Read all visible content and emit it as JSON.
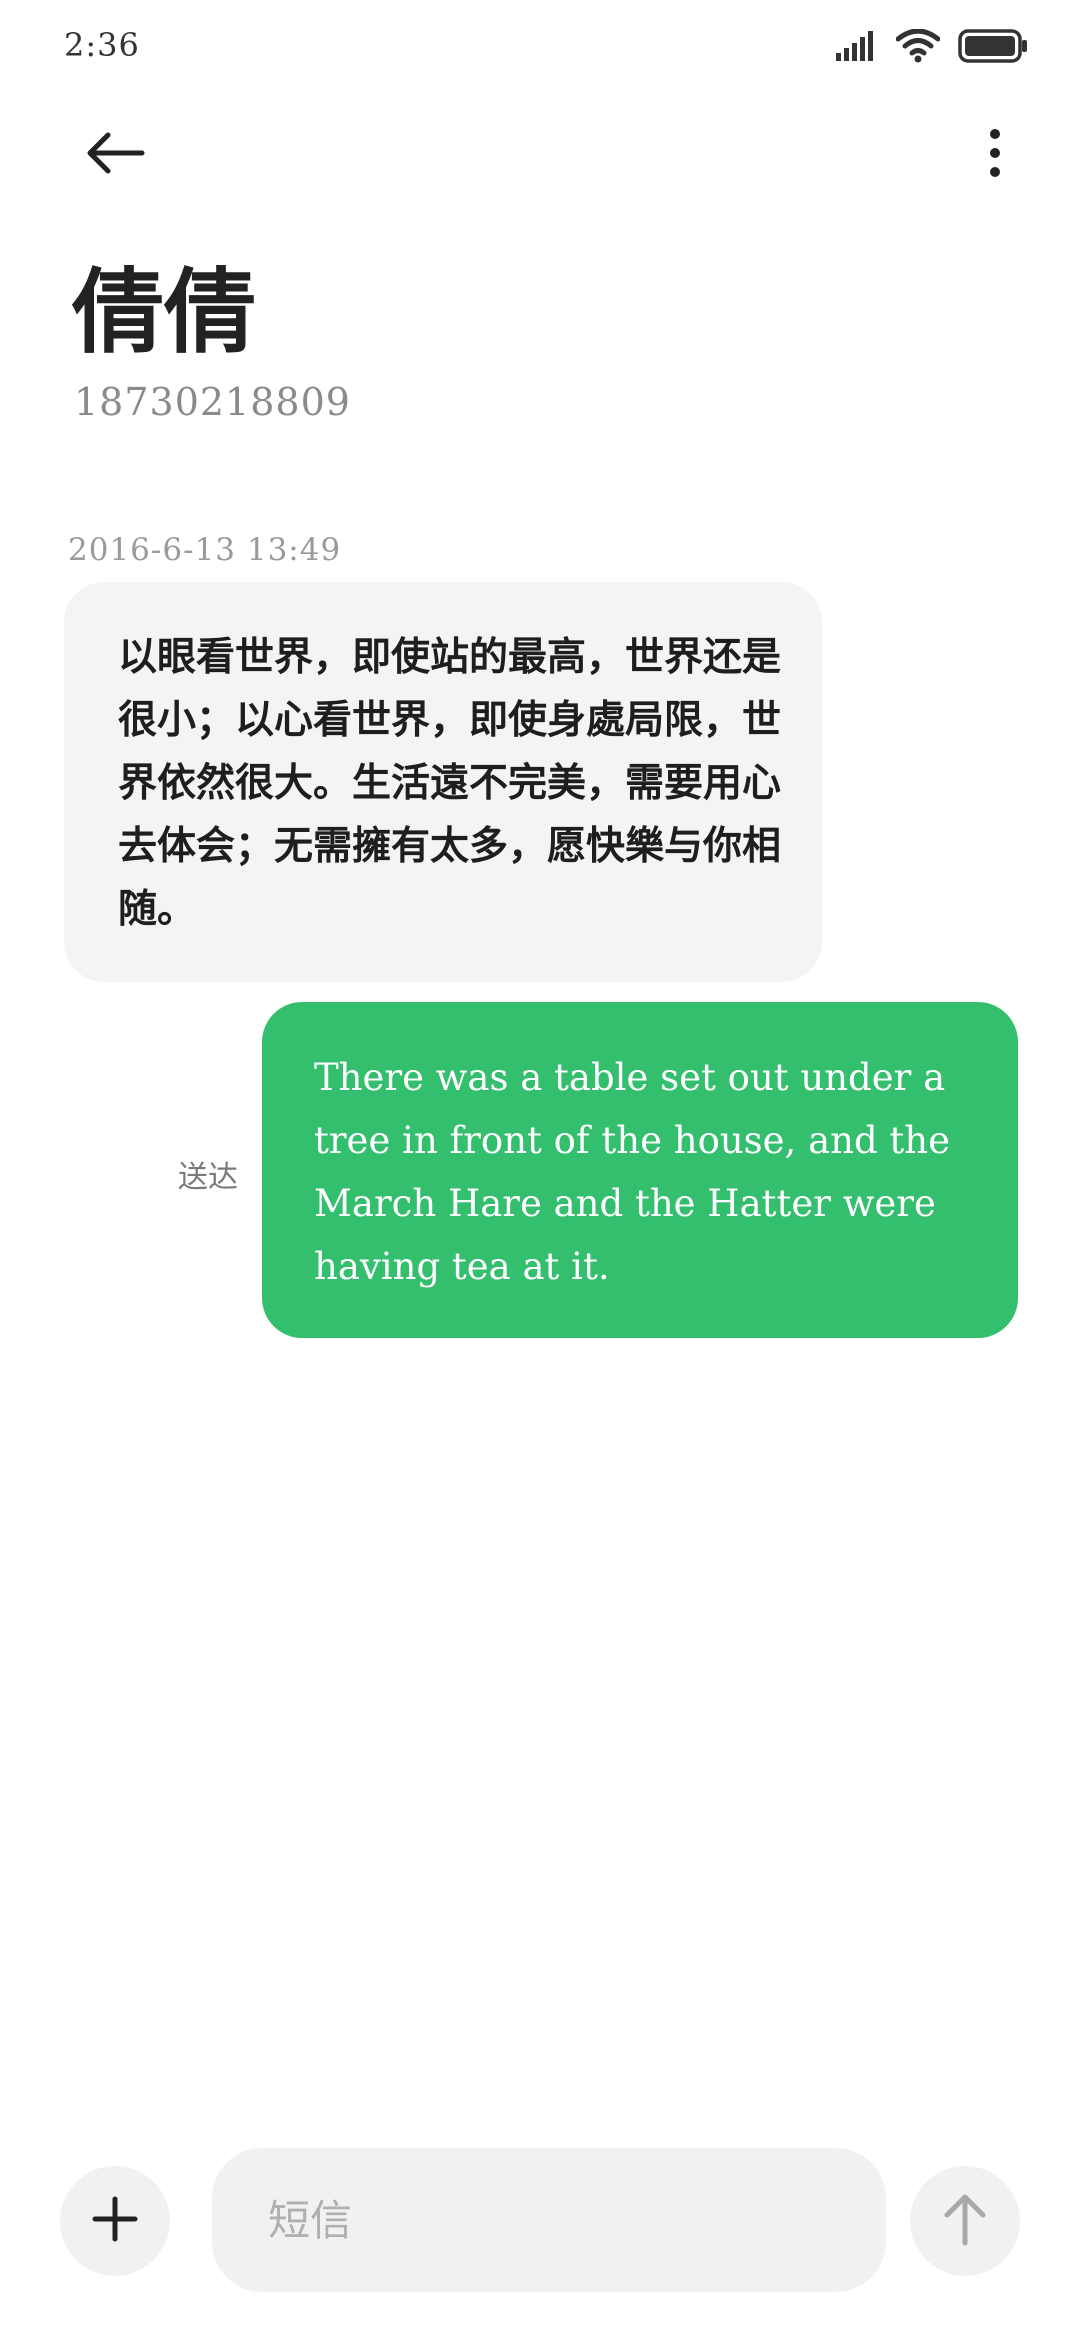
{
  "status_bar": {
    "time": "2:36",
    "icons": [
      "signal-icon",
      "wifi-icon",
      "battery-icon"
    ]
  },
  "app_bar": {
    "icons": [
      "arrow-left-icon",
      "more-vertical-icon"
    ]
  },
  "contact": {
    "name": "倩倩",
    "number": "18730218809"
  },
  "conversation": {
    "timestamp": "2016-6-13 13:49",
    "messages": [
      {
        "direction": "incoming",
        "text": "以眼看世界，即使站的最高，世界还是很小；以心看世界，即使身處局限，世界依然很大。生活遠不完美，需要用心去体会；无需擁有太多，愿快樂与你相随。"
      },
      {
        "direction": "outgoing",
        "text": "There was a table set out under a tree in front of the house, and the March Hare and the Hatter were having tea at it.",
        "status": "送达"
      }
    ]
  },
  "composer": {
    "placeholder": "短信",
    "attach_icon": "plus-icon",
    "send_icon": "arrow-up-icon"
  },
  "colors": {
    "outgoing_bubble": "#33bf6e",
    "incoming_bubble": "#f4f4f4",
    "secondary_text": "#8a8a8a"
  }
}
